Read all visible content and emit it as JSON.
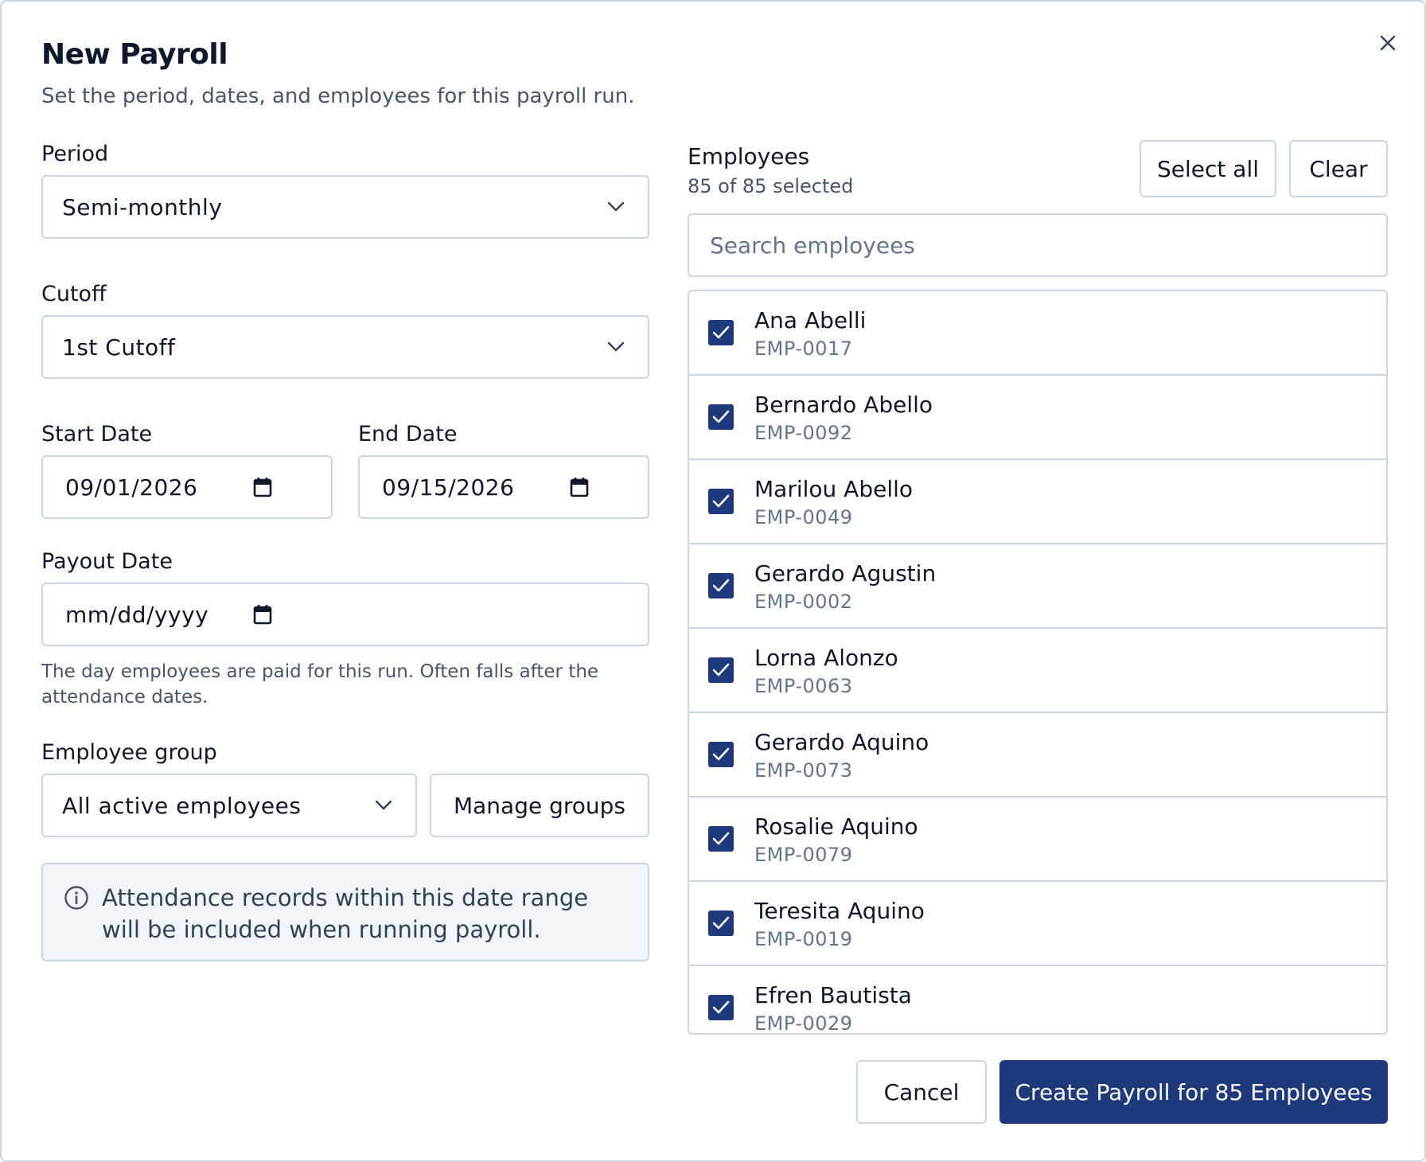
{
  "dialog": {
    "title": "New Payroll",
    "subtitle": "Set the period, dates, and employees for this payroll run."
  },
  "form": {
    "period_label": "Period",
    "period_value": "Semi-monthly",
    "cutoff_label": "Cutoff",
    "cutoff_value": "1st Cutoff",
    "start_date_label": "Start Date",
    "start_date_value": "09/01/2026",
    "end_date_label": "End Date",
    "end_date_value": "09/15/2026",
    "payout_date_label": "Payout Date",
    "payout_date_placeholder": "mm/dd/yyyy",
    "payout_hint": "The day employees are paid for this run. Often falls after the attendance dates.",
    "group_label": "Employee group",
    "group_value": "All active employees",
    "manage_groups": "Manage groups",
    "info_text": "Attendance records within this date range will be included when running payroll."
  },
  "employees": {
    "label": "Employees",
    "count_text": "85 of 85 selected",
    "select_all": "Select all",
    "clear": "Clear",
    "search_placeholder": "Search employees",
    "items": [
      {
        "name": "Ana Abelli",
        "code": "EMP-0017",
        "checked": true
      },
      {
        "name": "Bernardo Abello",
        "code": "EMP-0092",
        "checked": true
      },
      {
        "name": "Marilou Abello",
        "code": "EMP-0049",
        "checked": true
      },
      {
        "name": "Gerardo Agustin",
        "code": "EMP-0002",
        "checked": true
      },
      {
        "name": "Lorna Alonzo",
        "code": "EMP-0063",
        "checked": true
      },
      {
        "name": "Gerardo Aquino",
        "code": "EMP-0073",
        "checked": true
      },
      {
        "name": "Rosalie Aquino",
        "code": "EMP-0079",
        "checked": true
      },
      {
        "name": "Teresita Aquino",
        "code": "EMP-0019",
        "checked": true
      },
      {
        "name": "Efren Bautista",
        "code": "EMP-0029",
        "checked": true
      }
    ]
  },
  "footer": {
    "cancel": "Cancel",
    "submit": "Create Payroll for 85 Employees"
  },
  "colors": {
    "primary": "#1e3a7b",
    "border": "#cbd5e1",
    "info_bg": "#f1f5f9"
  },
  "icons": {
    "close": "close-icon",
    "chevron": "chevron-down-icon",
    "calendar": "calendar-icon",
    "info": "info-icon",
    "check": "check-icon"
  }
}
